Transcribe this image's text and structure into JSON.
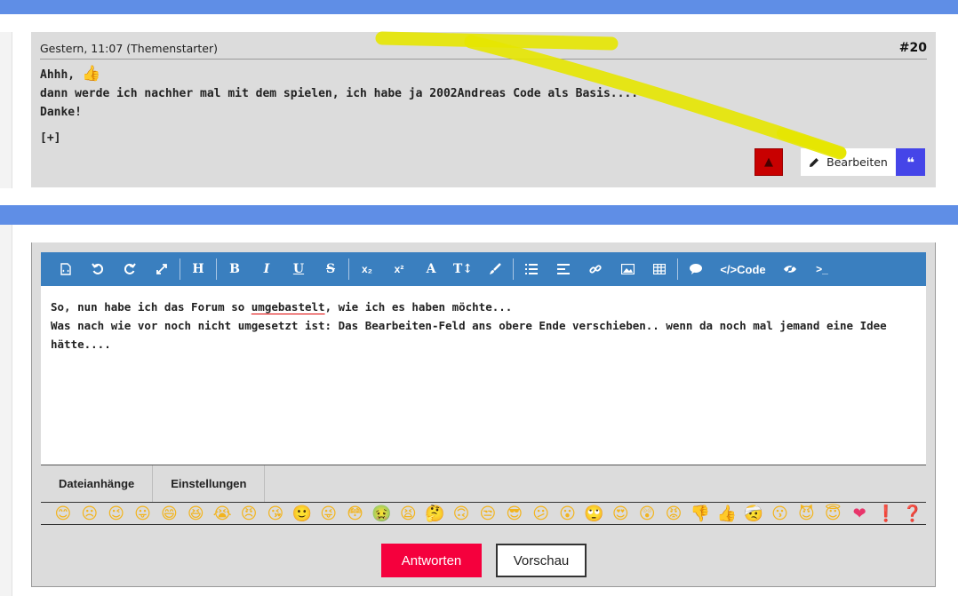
{
  "post": {
    "meta": "Gestern, 11:07 (Themenstarter)",
    "number": "#20",
    "line1": "Ahhh,",
    "line2": "dann werde ich nachher mal mit dem spielen, ich habe ja 2002Andreas Code als Basis....",
    "line3": "Danke!",
    "expand": "[+]",
    "edit_label": "Bearbeiten",
    "quote_glyph": "❝",
    "report_glyph": "▲"
  },
  "toolbar": {
    "heading": "H",
    "bold": "B",
    "italic": "I",
    "underline": "U",
    "strike": "S",
    "sub": "x₂",
    "sup": "x²",
    "font": "A",
    "size": "T↕",
    "code_label": "</>Code",
    "terminal": ">_"
  },
  "editor": {
    "line1_a": "So, nun habe ich das Forum so ",
    "line1_spell": "umgebastelt",
    "line1_b": ", wie ich es haben möchte...",
    "line2": "Was nach wie vor noch nicht umgesetzt ist: Das Bearbeiten-Feld ans obere Ende verschieben.. wenn da noch mal jemand eine Idee hätte...."
  },
  "tabs": {
    "attachments": "Dateianhänge",
    "settings": "Einstellungen"
  },
  "emojis": [
    "😊",
    "☹",
    "😉",
    "😛",
    "😄",
    "😆",
    "😭",
    "😠",
    "😘",
    "🙂",
    "😜",
    "😳",
    "🤢",
    "😫",
    "🤔",
    "🙃",
    "😒",
    "😎",
    "😕",
    "😮",
    "🙄",
    "😍",
    "😲",
    "😡",
    "👎",
    "👍",
    "🤕",
    "😗",
    "😈",
    "😇",
    "❤",
    "❗",
    "❓"
  ],
  "actions": {
    "answer": "Antworten",
    "preview": "Vorschau"
  },
  "colors": {
    "brand_bar": "#5f8ee6",
    "toolbar": "#3a7fbf",
    "answer_button": "#f5003d",
    "quote_button": "#4545e8",
    "report_button": "#c80000",
    "highlighter": "#e6e600"
  }
}
